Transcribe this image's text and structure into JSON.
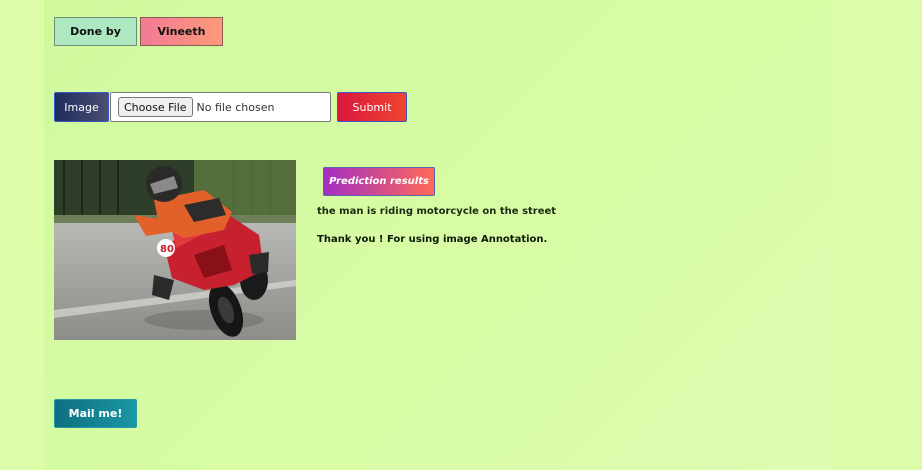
{
  "credits": {
    "done_label": "Done by",
    "author": "Vineeth"
  },
  "upload": {
    "image_label": "Image",
    "choose_label": "Choose File",
    "file_status": "No file chosen",
    "submit_label": "Submit"
  },
  "result": {
    "button_label": "Prediction results",
    "caption": "the man is riding motorcycle on the street",
    "thanks": "Thank you ! For using image Annotation."
  },
  "mail": {
    "label": "Mail me!"
  },
  "colors": {
    "background": "#dcfcaa",
    "done_bg": "#aee8c0",
    "author_bg": "#f27a96",
    "submit_bg": "#d9183f",
    "prediction_bg": "#a22fc2",
    "mail_bg": "#0e6f80"
  },
  "image": {
    "alt": "motorcycle-rider-photo"
  }
}
